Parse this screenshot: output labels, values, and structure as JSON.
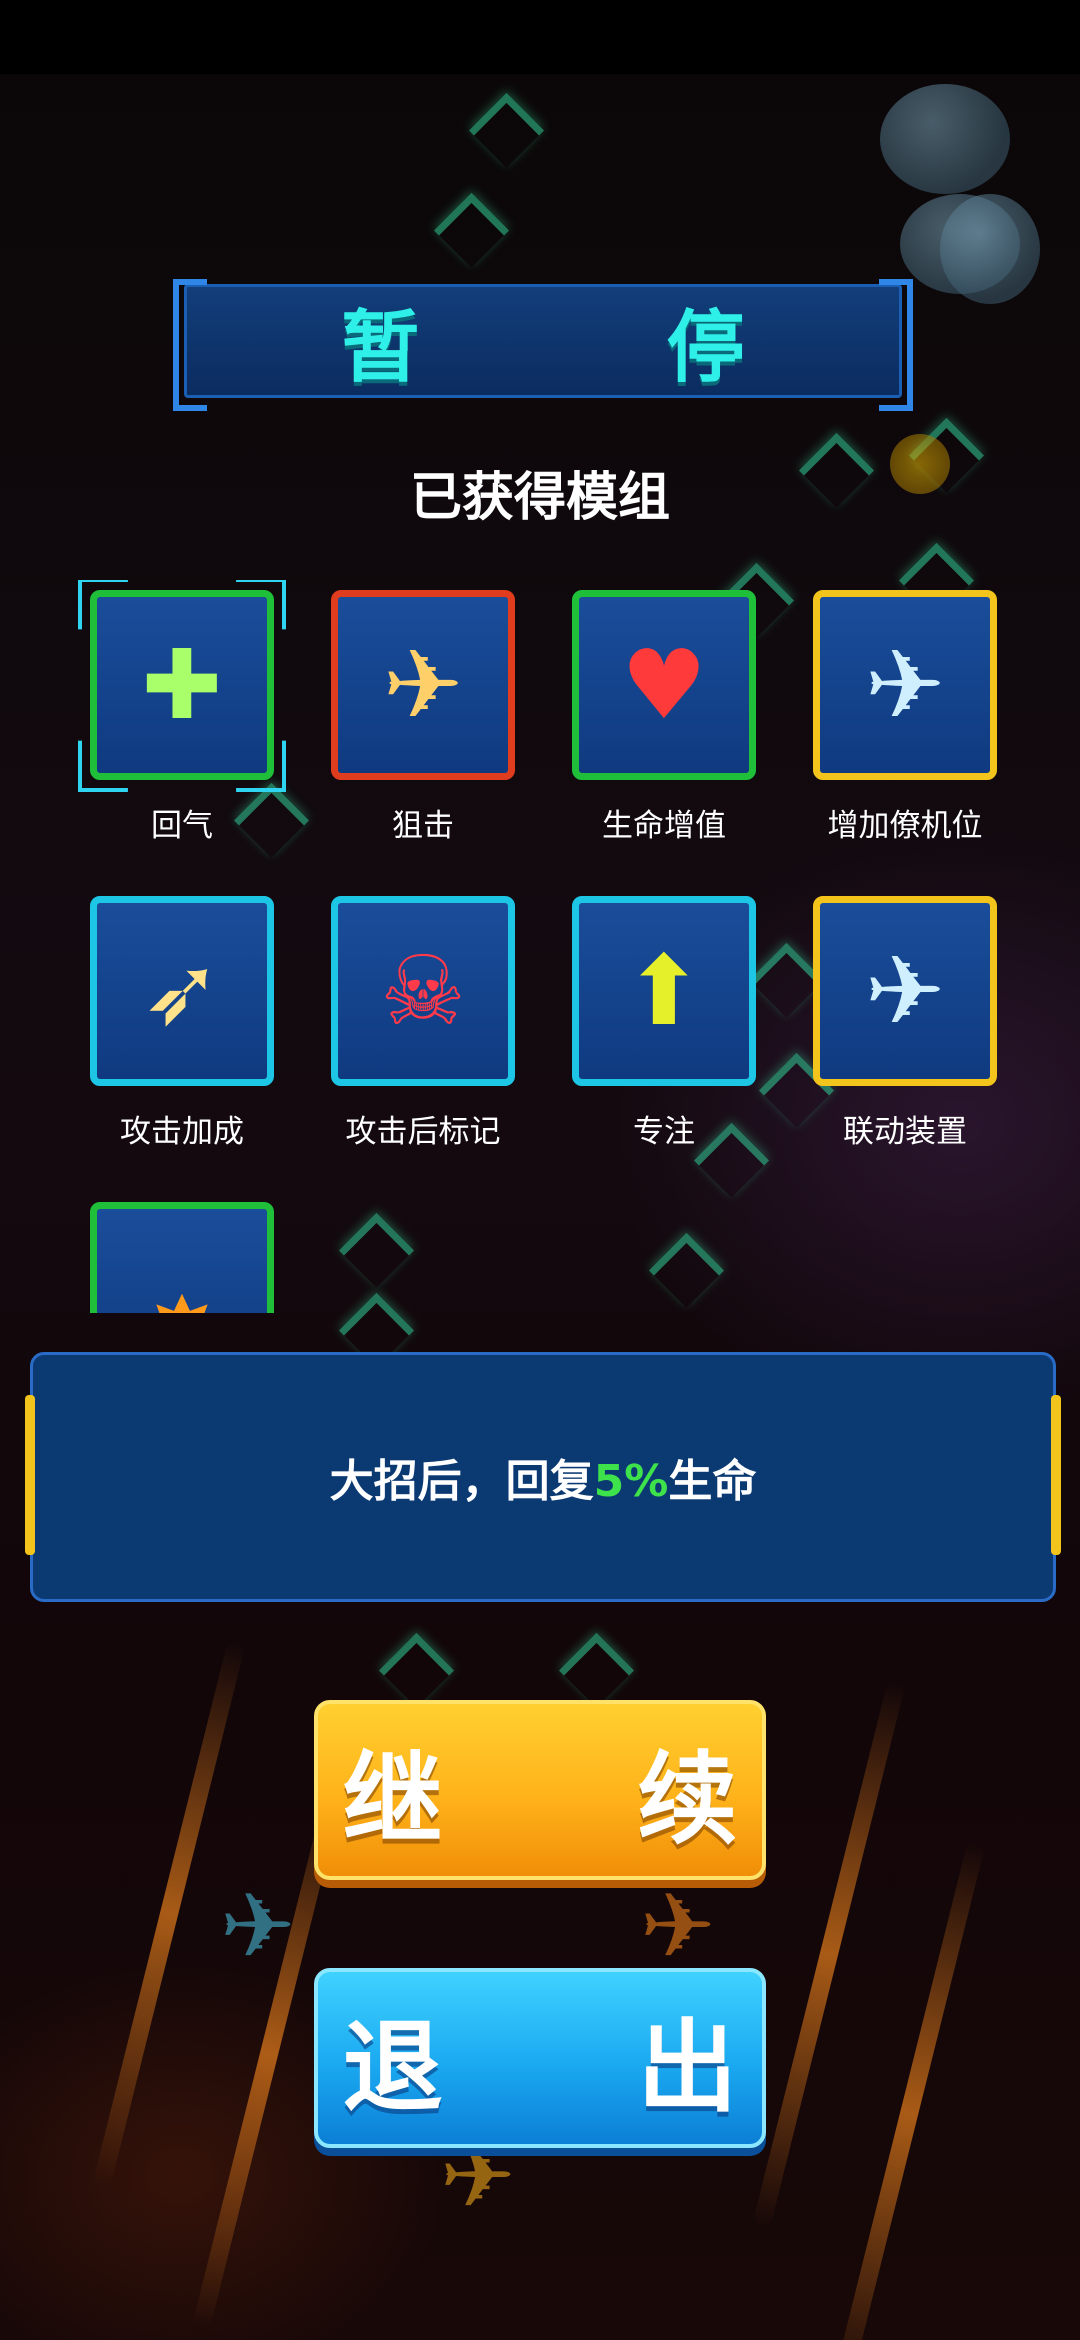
{
  "title": "暂 停",
  "modules_heading": "已获得模组",
  "modules": [
    {
      "label": "回气",
      "border": "#1fbf3a",
      "icon": "heal-plane-icon",
      "glyph": "✚",
      "selected": true
    },
    {
      "label": "狙击",
      "border": "#e03c1e",
      "icon": "sniper-plane-icon",
      "glyph": "✈",
      "selected": false
    },
    {
      "label": "生命增值",
      "border": "#1fbf3a",
      "icon": "heart-plane-icon",
      "glyph": "♥",
      "selected": false
    },
    {
      "label": "增加僚机位",
      "border": "#f2c41c",
      "icon": "wingman-slot-icon",
      "glyph": "✈",
      "selected": false
    },
    {
      "label": "攻击加成",
      "border": "#1ec6e6",
      "icon": "missile-icon",
      "glyph": "➶",
      "selected": false
    },
    {
      "label": "攻击后标记",
      "border": "#1ec6e6",
      "icon": "target-skull-icon",
      "glyph": "☠",
      "selected": false
    },
    {
      "label": "专注",
      "border": "#1ec6e6",
      "icon": "focus-arrow-icon",
      "glyph": "⬆",
      "selected": false
    },
    {
      "label": "联动装置",
      "border": "#f2c41c",
      "icon": "mp-link-icon",
      "glyph": "✈",
      "selected": false
    },
    {
      "label": "",
      "border": "#1fbf3a",
      "icon": "explosion-heal-icon",
      "glyph": "✸",
      "selected": false
    }
  ],
  "description": {
    "prefix": "大招后，回复",
    "highlight": "5%",
    "suffix": "生命"
  },
  "buttons": {
    "continue": "继 续",
    "exit": "退 出"
  }
}
